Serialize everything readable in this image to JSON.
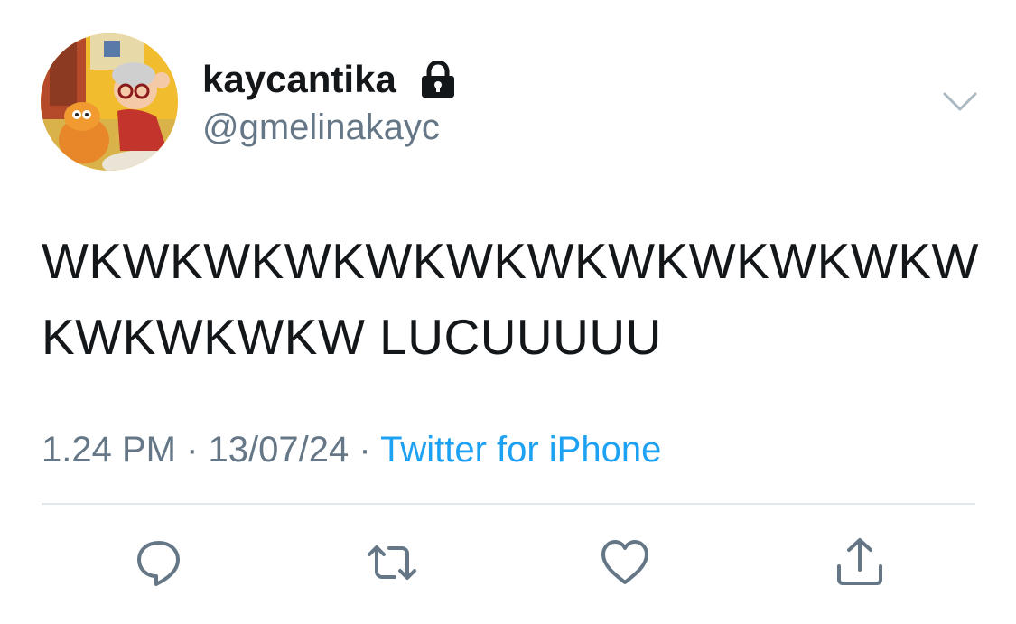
{
  "author": {
    "display_name": "kaycantika",
    "handle": "@gmelinakayc",
    "protected_icon": "lock-icon"
  },
  "tweet": {
    "lines": [
      "WKWKWKWKWKWKWKWKWKWKWKW",
      "KWKWKWKW LUCUUUUU"
    ],
    "time": "1.24 PM",
    "separator": "·",
    "date": "13/07/24",
    "source": "Twitter for iPhone"
  },
  "actions": [
    {
      "icon": "reply-icon"
    },
    {
      "icon": "retweet-icon"
    },
    {
      "icon": "like-icon"
    },
    {
      "icon": "share-icon"
    }
  ],
  "colors": {
    "text": "#14171a",
    "secondary": "#657786",
    "link": "#1da1f2",
    "divider": "#e1e8ed"
  }
}
